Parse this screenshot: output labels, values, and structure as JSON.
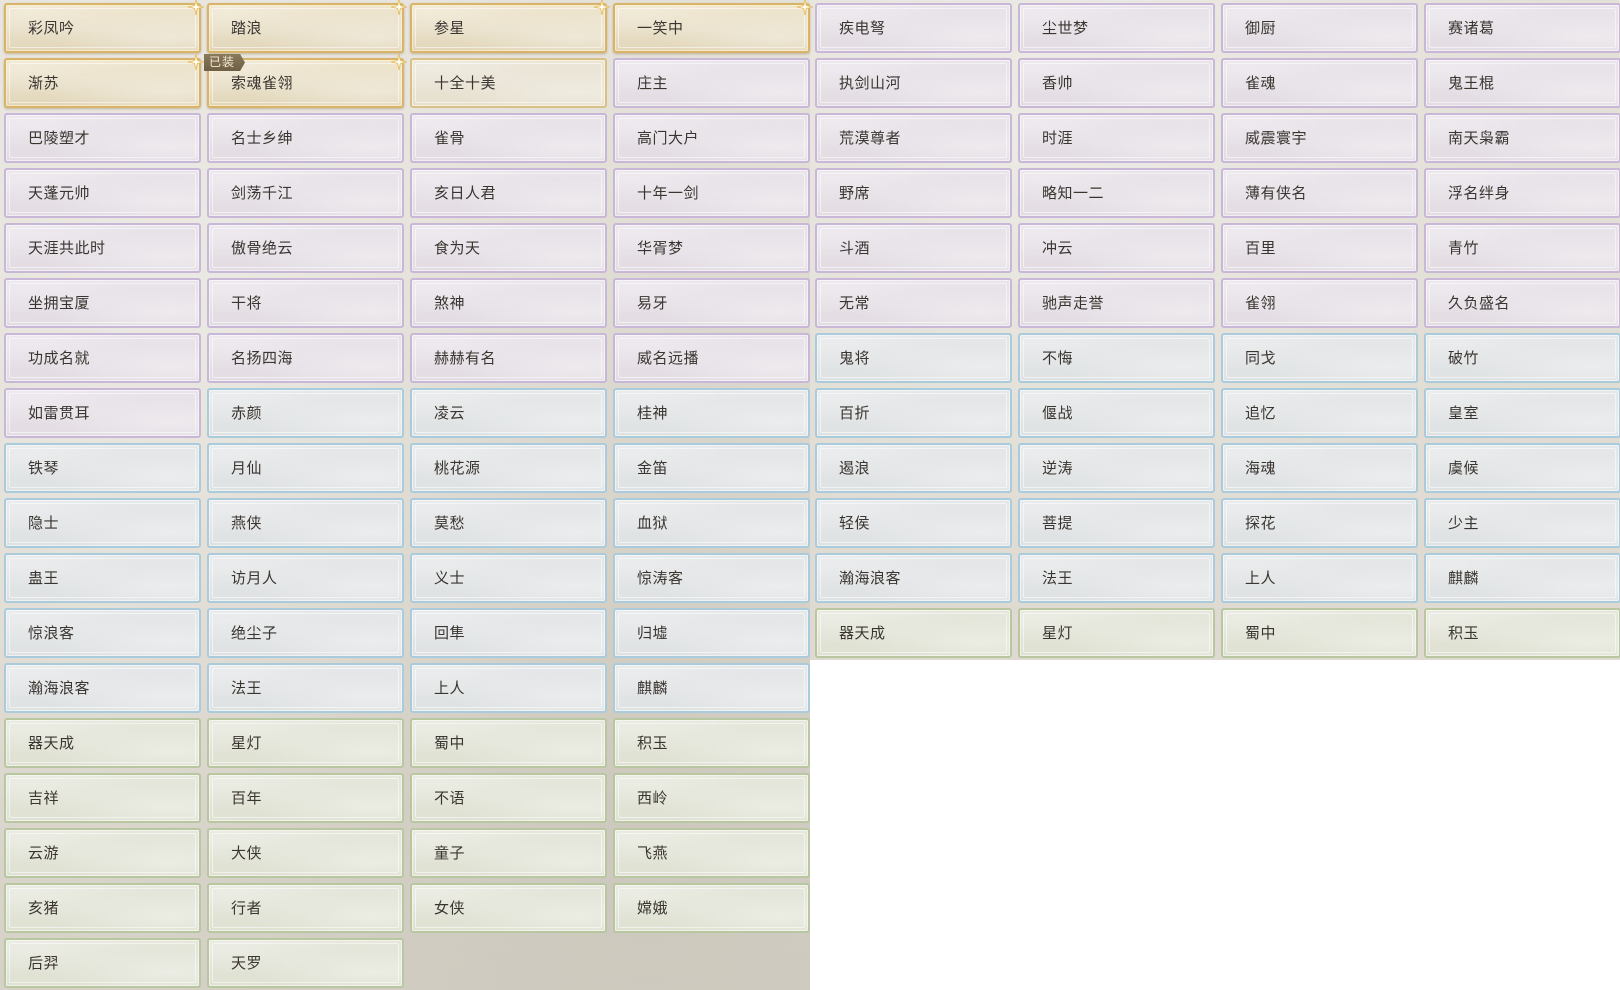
{
  "equipped_badge": "已装",
  "colors": {
    "gold": "#d7b46a",
    "purple": "#c8b7d6",
    "blue": "#a9cbdc",
    "green": "#b8c79f",
    "text": "#3a3530"
  },
  "titles_right": [
    [
      "疾电弩",
      "尘世梦",
      "御厨",
      "赛诸葛"
    ],
    [
      "执剑山河",
      "香帅",
      "雀魂",
      "鬼王棍"
    ],
    [
      "荒漠尊者",
      "时涯",
      "威震寰宇",
      "南天枭霸"
    ],
    [
      "野席",
      "略知一二",
      "薄有侠名",
      "浮名绊身"
    ],
    [
      "斗酒",
      "冲云",
      "百里",
      "青竹"
    ],
    [
      "无常",
      "驰声走誉",
      "雀翎",
      "久负盛名"
    ],
    [
      "鬼将",
      "不悔",
      "同戈",
      "破竹"
    ],
    [
      "百折",
      "偃战",
      "追忆",
      "皇室"
    ],
    [
      "遏浪",
      "逆涛",
      "海魂",
      "虞候"
    ],
    [
      "轻侯",
      "菩提",
      "探花",
      "少主"
    ],
    [
      "瀚海浪客",
      "法王",
      "上人",
      "麒麟"
    ],
    [
      "器天成",
      "星灯",
      "蜀中",
      "积玉"
    ]
  ],
  "titles_left": [
    [
      "彩凤吟",
      "踏浪",
      "参星",
      "一笑中"
    ],
    [
      "渐苏",
      "索魂雀翎",
      "十全十美",
      "庄主"
    ],
    [
      "巴陵塑才",
      "名士乡绅",
      "雀骨",
      "高门大户"
    ],
    [
      "天蓬元帅",
      "剑荡千江",
      "亥日人君",
      "十年一剑"
    ],
    [
      "天涯共此时",
      "傲骨绝云",
      "食为天",
      "华胥梦"
    ],
    [
      "坐拥宝厦",
      "干将",
      "煞神",
      "易牙"
    ],
    [
      "功成名就",
      "名扬四海",
      "赫赫有名",
      "威名远播"
    ],
    [
      "如雷贯耳",
      "赤颜",
      "凌云",
      "桂神"
    ],
    [
      "铁琴",
      "月仙",
      "桃花源",
      "金笛"
    ],
    [
      "隐士",
      "燕侠",
      "莫愁",
      "血狱"
    ],
    [
      "蛊王",
      "访月人",
      "义士",
      "惊涛客"
    ],
    [
      "惊浪客",
      "绝尘子",
      "回隼",
      "归墟"
    ],
    [
      "瀚海浪客",
      "法王",
      "上人",
      "麒麟"
    ],
    [
      "器天成",
      "星灯",
      "蜀中",
      "积玉"
    ],
    [
      "吉祥",
      "百年",
      "不语",
      "西岭"
    ],
    [
      "云游",
      "大侠",
      "童子",
      "飞燕"
    ],
    [
      "亥猪",
      "行者",
      "女侠",
      "嫦娥"
    ],
    [
      "后羿",
      "天罗"
    ]
  ]
}
